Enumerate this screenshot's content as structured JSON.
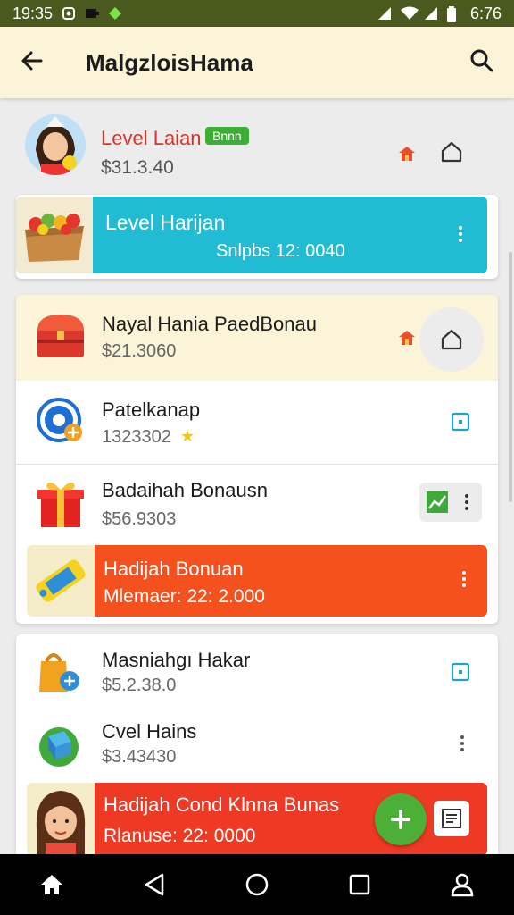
{
  "status": {
    "time": "19:35",
    "battery": "6:76"
  },
  "appbar": {
    "title": "MalgzloisHama"
  },
  "profile": {
    "level": "Level Laian",
    "badge": "Bnnn",
    "amount": "$31.3.40"
  },
  "banner1": {
    "title": "Level Harijan",
    "subtitle": "Snlpbs 12: 0040",
    "color": "#21bcd4"
  },
  "list": [
    {
      "title": "Nayal Hania PaedBonau",
      "value": "$21.3060"
    },
    {
      "title": "Patelkanap",
      "value": "1323302"
    },
    {
      "title": "Badaihah Bonausn",
      "value": "$56.9303"
    }
  ],
  "banner2": {
    "title": "Hadijah Bonuan",
    "subtitle": "Mlemaer: 22: 2.000",
    "color": "#f5511f"
  },
  "list2": [
    {
      "title": "Masniahgı Hakar",
      "value": "$5.2.38.0"
    },
    {
      "title": "Cvel Hains",
      "value": "$3.43430"
    }
  ],
  "banner3": {
    "title": "Hadijah Cond Klnna Bunas",
    "subtitle": "Rlanuse: 22: 0000",
    "color": "#ee3a24"
  },
  "colors": {
    "accent_teal": "#21bcd4",
    "accent_orange": "#f5511f",
    "accent_red": "#ee3a24",
    "green_fab": "#4caf38"
  }
}
